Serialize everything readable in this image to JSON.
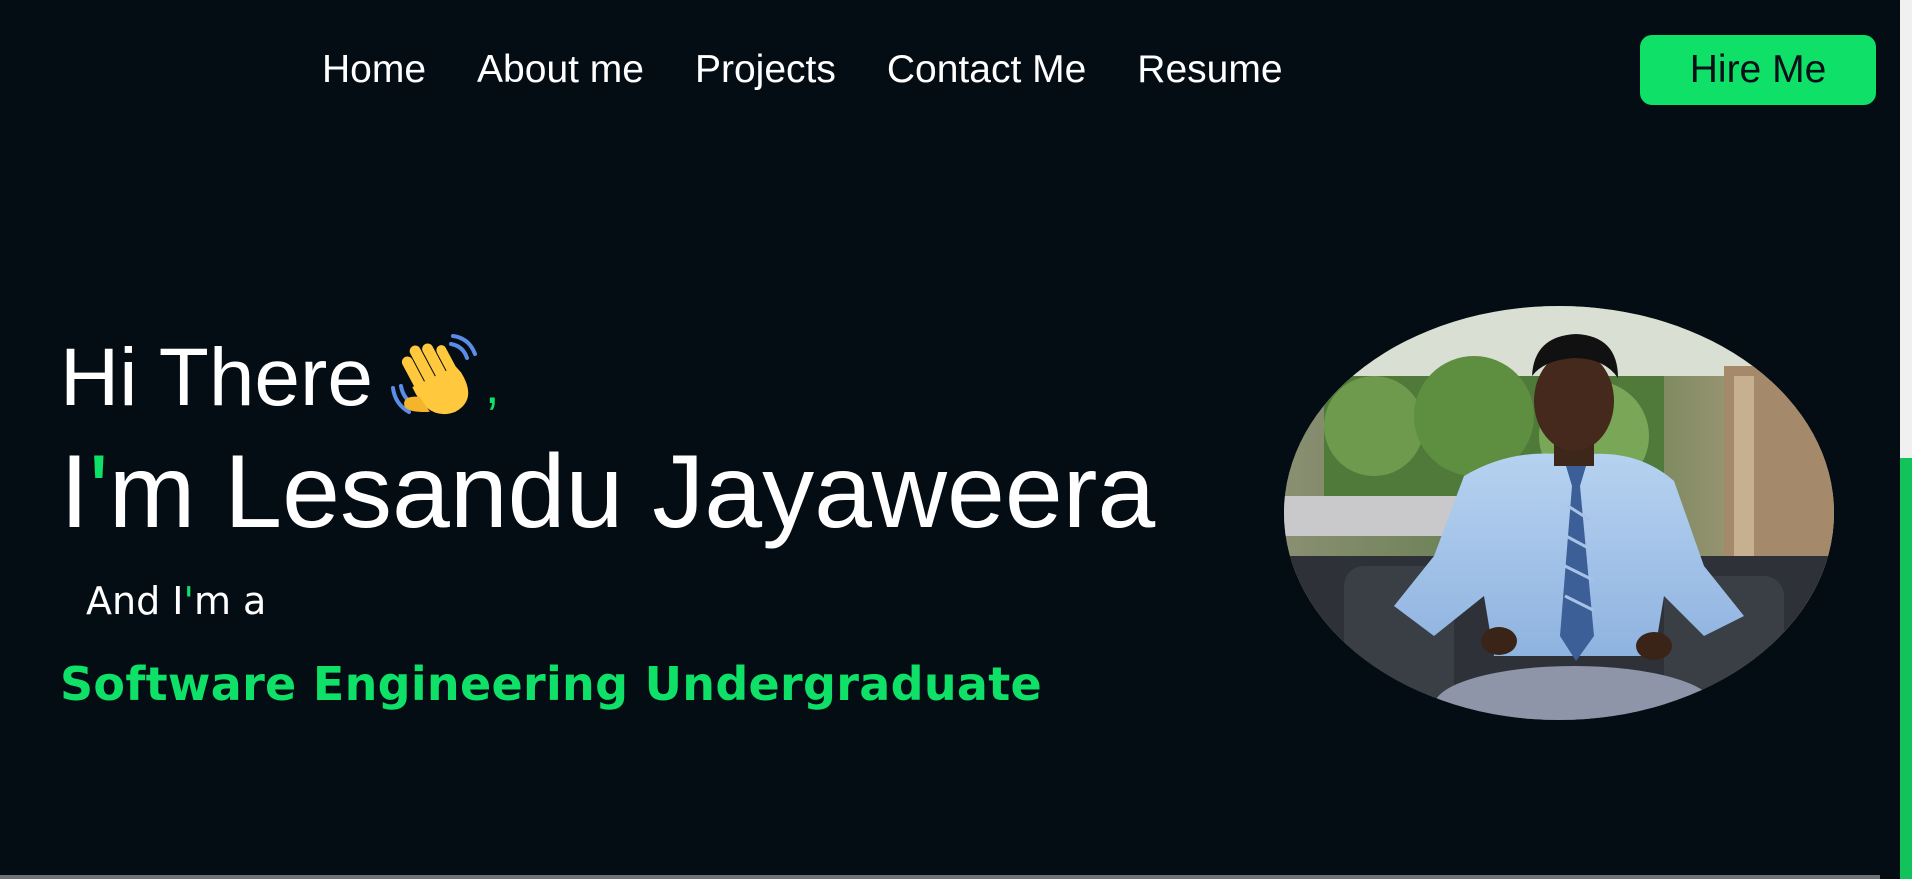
{
  "nav": {
    "links": [
      "Home",
      "About me",
      "Projects",
      "Contact Me",
      "Resume"
    ],
    "hire_label": "Hire Me"
  },
  "hero": {
    "greeting": "Hi There",
    "greeting_icon": "waving-hand-icon",
    "greeting_punct": ",",
    "name_prefix": "I",
    "name_apostrophe": "'",
    "name_rest": "m Lesandu Jayaweera",
    "sub_prefix": "And I",
    "sub_apostrophe": "'",
    "sub_rest": "m a",
    "role": "Software Engineering Undergraduate"
  },
  "colors": {
    "background": "#050d14",
    "accent": "#0fe068",
    "text": "#ffffff"
  }
}
